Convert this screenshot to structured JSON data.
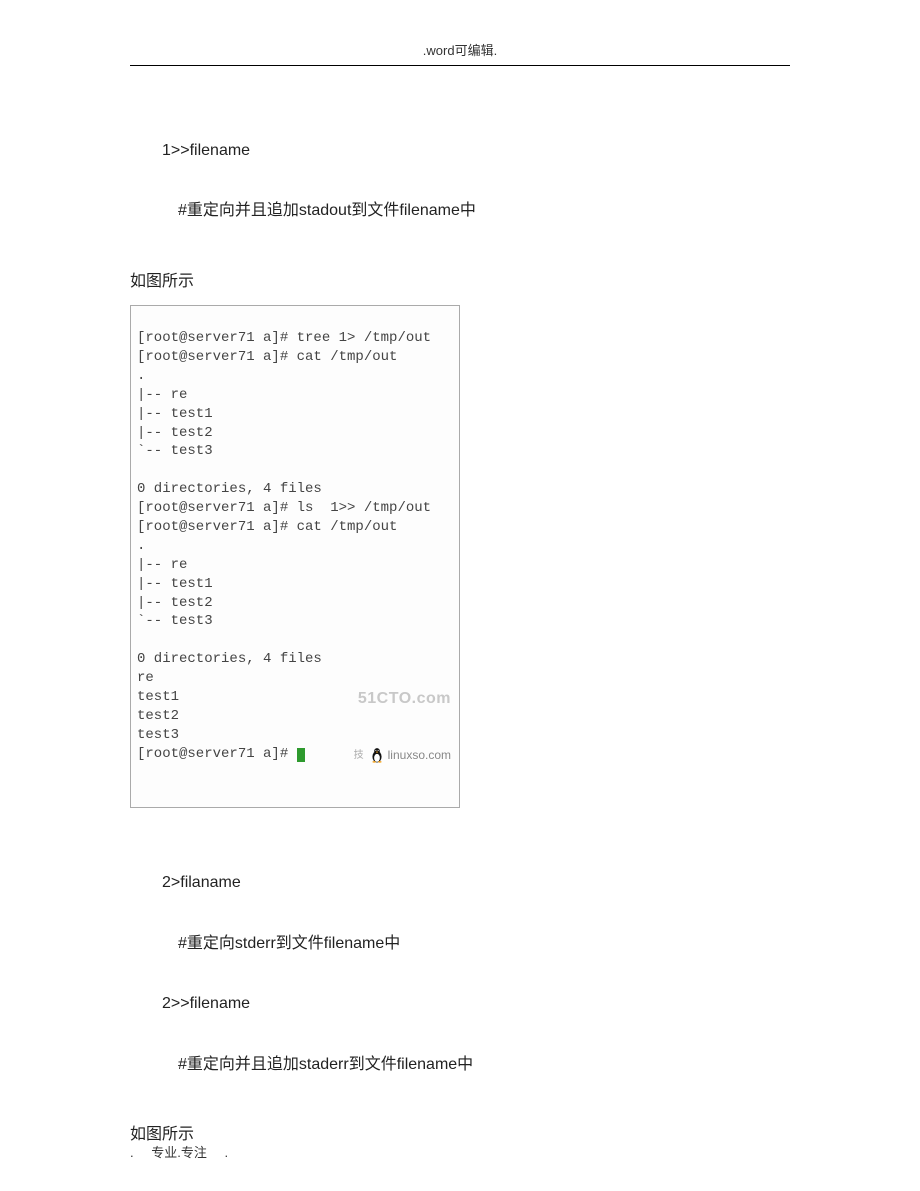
{
  "header": {
    "label": ".word可编辑."
  },
  "body": {
    "line1": "1>>filename",
    "line2": "#重定向并且追加stadout到文件filename中",
    "line3": "如图所示",
    "line4": "2>filaname",
    "line5": "#重定向stderr到文件filename中",
    "line6": "2>>filename",
    "line7": "#重定向并且追加staderr到文件filename中",
    "line8": "如图所示"
  },
  "terminal": {
    "lines": [
      "[root@server71 a]# tree 1> /tmp/out",
      "[root@server71 a]# cat /tmp/out",
      ".",
      "|-- re",
      "|-- test1",
      "|-- test2",
      "`-- test3",
      "",
      "0 directories, 4 files",
      "[root@server71 a]# ls  1>> /tmp/out",
      "[root@server71 a]# cat /tmp/out",
      ".",
      "|-- re",
      "|-- test1",
      "|-- test2",
      "`-- test3",
      "",
      "0 directories, 4 files",
      "re",
      "test1",
      "test2",
      "test3"
    ],
    "prompt_last": "[root@server71 a]# "
  },
  "watermark": {
    "top": "51CTO.com",
    "cn_small": "技",
    "bottom": "linuxso.com"
  },
  "footer": {
    "left_dot": ".",
    "text": "专业.专注",
    "right_dot": "."
  }
}
